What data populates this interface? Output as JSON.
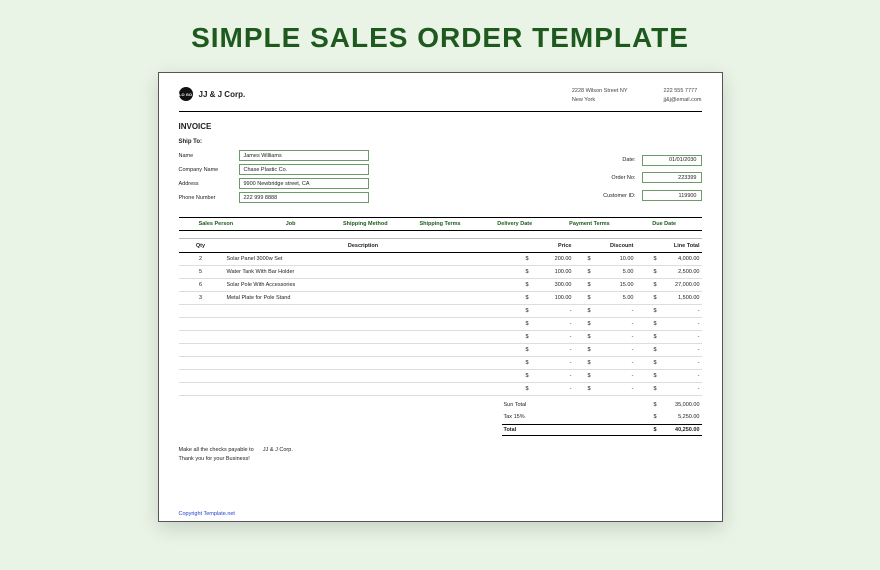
{
  "page_title": "SIMPLE SALES ORDER TEMPLATE",
  "header": {
    "logo_text": "LO\nGO",
    "company": "JJ & J Corp.",
    "address_line1": "2228 Wilson Street NY",
    "address_line2": "New York",
    "phone": "222 555 7777",
    "email": "jj&j@email.com"
  },
  "doc_label": "INVOICE",
  "ship_to": {
    "title": "Ship To:",
    "labels": {
      "name": "Name",
      "company": "Company Name",
      "address": "Address",
      "phone": "Phone Number"
    },
    "name": "James Williams",
    "company": "Chase Plastic Co.",
    "address": "9900 Newbridge street, CA",
    "phone": "222 999 8888"
  },
  "meta": {
    "labels": {
      "date": "Date:",
      "order_no": "Order No:",
      "customer_id": "Customer ID:"
    },
    "date": "01/01/2030",
    "order_no": "223399",
    "customer_id": "119900"
  },
  "section_headers": [
    "Sales Person",
    "Job",
    "Shipping Method",
    "Shipping Terms",
    "Delivery Date",
    "Payment Terms",
    "Due Date"
  ],
  "item_headers": {
    "qty": "Qty",
    "desc": "Description",
    "price": "Price",
    "discount": "Discount",
    "line_total": "Line Total"
  },
  "items": [
    {
      "qty": "2",
      "desc": "Solar Panel 3000w Set",
      "price": "200.00",
      "discount": "10.00",
      "line_total": "4,000.00"
    },
    {
      "qty": "5",
      "desc": "Water Tank With Bar Holder",
      "price": "100.00",
      "discount": "5.00",
      "line_total": "2,500.00"
    },
    {
      "qty": "6",
      "desc": "Solar Pole With Accessories",
      "price": "300.00",
      "discount": "15.00",
      "line_total": "27,000.00"
    },
    {
      "qty": "3",
      "desc": "Metal Plate for Pole Stand",
      "price": "100.00",
      "discount": "5.00",
      "line_total": "1,500.00"
    },
    {
      "qty": "",
      "desc": "",
      "price": "-",
      "discount": "-",
      "line_total": "-"
    },
    {
      "qty": "",
      "desc": "",
      "price": "-",
      "discount": "-",
      "line_total": "-"
    },
    {
      "qty": "",
      "desc": "",
      "price": "-",
      "discount": "-",
      "line_total": "-"
    },
    {
      "qty": "",
      "desc": "",
      "price": "-",
      "discount": "-",
      "line_total": "-"
    },
    {
      "qty": "",
      "desc": "",
      "price": "-",
      "discount": "-",
      "line_total": "-"
    },
    {
      "qty": "",
      "desc": "",
      "price": "-",
      "discount": "-",
      "line_total": "-"
    },
    {
      "qty": "",
      "desc": "",
      "price": "-",
      "discount": "-",
      "line_total": "-"
    }
  ],
  "totals": {
    "subtotal_label": "Sun Total",
    "subtotal": "35,000.00",
    "tax_label": "Tax 15%",
    "tax": "5,250.00",
    "total_label": "Total",
    "total": "40,250.00"
  },
  "footer": {
    "payable_prefix": "Make all the checks payable to",
    "payable_to": "JJ & J Corp.",
    "thanks": "Thank you for your Business!"
  },
  "copyright": "Copyright Template.net",
  "currency": "$"
}
